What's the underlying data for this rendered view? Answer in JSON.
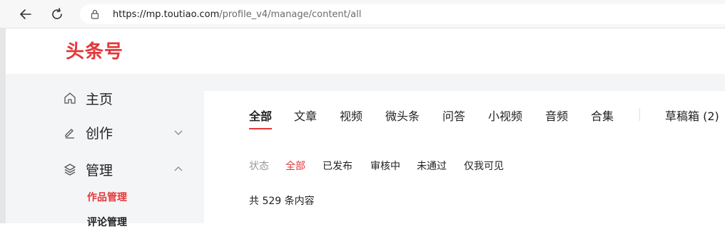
{
  "browser": {
    "url_host": "https://mp.toutiao.com",
    "url_path": "/profile_v4/manage/content/all"
  },
  "header": {
    "logo": "头条号"
  },
  "sidebar": {
    "items": [
      {
        "label": "主页",
        "icon": "home-icon"
      },
      {
        "label": "创作",
        "icon": "edit-icon"
      },
      {
        "label": "管理",
        "icon": "layers-icon"
      }
    ],
    "sub_items": [
      {
        "label": "作品管理",
        "active": true
      },
      {
        "label": "评论管理",
        "active": false
      }
    ]
  },
  "main": {
    "tabs": [
      "全部",
      "文章",
      "视频",
      "微头条",
      "问答",
      "小视频",
      "音频",
      "合集"
    ],
    "drafts": "草稿箱 (2)",
    "filter_label": "状态",
    "filters": [
      "全部",
      "已发布",
      "审核中",
      "未通过",
      "仅我可见"
    ],
    "count_text": "共 529 条内容"
  },
  "colors": {
    "accent": "#e5363a"
  }
}
